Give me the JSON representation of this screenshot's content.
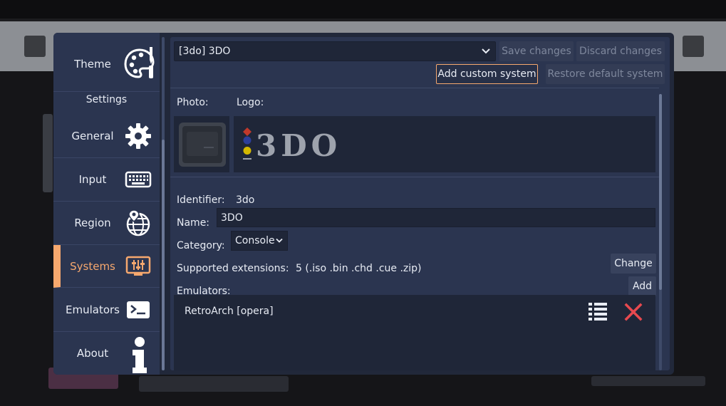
{
  "sidebar": {
    "theme_label": "Theme",
    "settings_heading": "Settings",
    "items": [
      {
        "label": "General",
        "icon": "gear-icon"
      },
      {
        "label": "Input",
        "icon": "keyboard-icon"
      },
      {
        "label": "Region",
        "icon": "globe-icon"
      },
      {
        "label": "Systems",
        "icon": "monitor-sliders-icon",
        "active": true
      },
      {
        "label": "Emulators",
        "icon": "terminal-icon"
      },
      {
        "label": "About",
        "icon": "info-icon"
      }
    ]
  },
  "toolbar": {
    "system_selected": "[3do] 3DO",
    "save_label": "Save changes",
    "discard_label": "Discard changes",
    "add_custom_label": "Add custom system",
    "restore_label": "Restore default system"
  },
  "media": {
    "photo_label": "Photo:",
    "logo_label": "Logo:",
    "logo_text": "3DO"
  },
  "fields": {
    "identifier_label": "Identifier:",
    "identifier_value": "3do",
    "name_label": "Name:",
    "name_value": "3DO",
    "category_label": "Category:",
    "category_value": "Console",
    "extensions_label": "Supported extensions:",
    "extensions_value": "5 (.iso .bin .chd .cue .zip)",
    "change_label": "Change",
    "emulators_label": "Emulators:",
    "add_label": "Add"
  },
  "emulators": [
    {
      "name": "RetroArch [opera]"
    }
  ],
  "colors": {
    "accent": "#f6a86e",
    "remove": "#e8494f"
  }
}
